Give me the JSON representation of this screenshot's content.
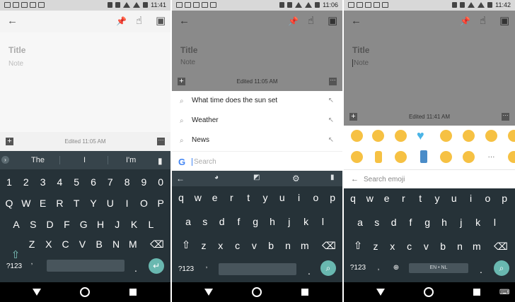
{
  "panel1": {
    "time": "11:41",
    "note_title": "Title",
    "note_hint": "Note",
    "edited": "Edited 11:05 AM",
    "suggestions": [
      "The",
      "I",
      "I'm"
    ],
    "rows": [
      [
        "1",
        "2",
        "3",
        "4",
        "5",
        "6",
        "7",
        "8",
        "9",
        "0"
      ],
      [
        "Q",
        "W",
        "E",
        "R",
        "T",
        "Y",
        "U",
        "I",
        "O",
        "P"
      ],
      [
        "A",
        "S",
        "D",
        "F",
        "G",
        "H",
        "J",
        "K",
        "L"
      ],
      [
        "Z",
        "X",
        "C",
        "V",
        "B",
        "N",
        "M"
      ]
    ],
    "symbols_key": "?123",
    "comma_key": ",",
    "period_key": "."
  },
  "panel2": {
    "time": "11:06",
    "note_title": "Title",
    "note_hint": "Note",
    "edited": "Edited 11:05 AM",
    "search_results": [
      "What time does the sun set",
      "Weather",
      "News"
    ],
    "search_placeholder": "Search",
    "google_letter": "G",
    "rows": [
      [
        "q",
        "w",
        "e",
        "r",
        "t",
        "y",
        "u",
        "i",
        "o",
        "p"
      ],
      [
        "a",
        "s",
        "d",
        "f",
        "g",
        "h",
        "j",
        "k",
        "l"
      ],
      [
        "z",
        "x",
        "c",
        "v",
        "b",
        "n",
        "m"
      ]
    ],
    "symbols_key": "?123",
    "comma_key": ",",
    "period_key": "."
  },
  "panel3": {
    "time": "11:42",
    "note_title": "Title",
    "note_hint": "Note",
    "edited": "Edited 11:41 AM",
    "emoji_search_placeholder": "Search emoji",
    "language_label": "EN • NL",
    "rows": [
      [
        "q",
        "w",
        "e",
        "r",
        "t",
        "y",
        "u",
        "i",
        "o",
        "p"
      ],
      [
        "a",
        "s",
        "d",
        "f",
        "g",
        "h",
        "j",
        "k",
        "l"
      ],
      [
        "z",
        "x",
        "c",
        "v",
        "b",
        "n",
        "m"
      ]
    ],
    "symbols_key": "?123",
    "comma_key": ",",
    "period_key": "."
  },
  "icons": {
    "back": "←",
    "pin": "📌",
    "touch": "☝",
    "archive": "▣",
    "search": "🔍",
    "arrow_fill": "↖",
    "palette": "🎨",
    "gear": "⚙",
    "mic": "🎤",
    "shift": "⇧",
    "delete": "⌫",
    "enter": "↵",
    "globe": "🌐"
  },
  "colors": {
    "keyboard_bg": "#263238",
    "enter_accent": "#69b8b0"
  }
}
